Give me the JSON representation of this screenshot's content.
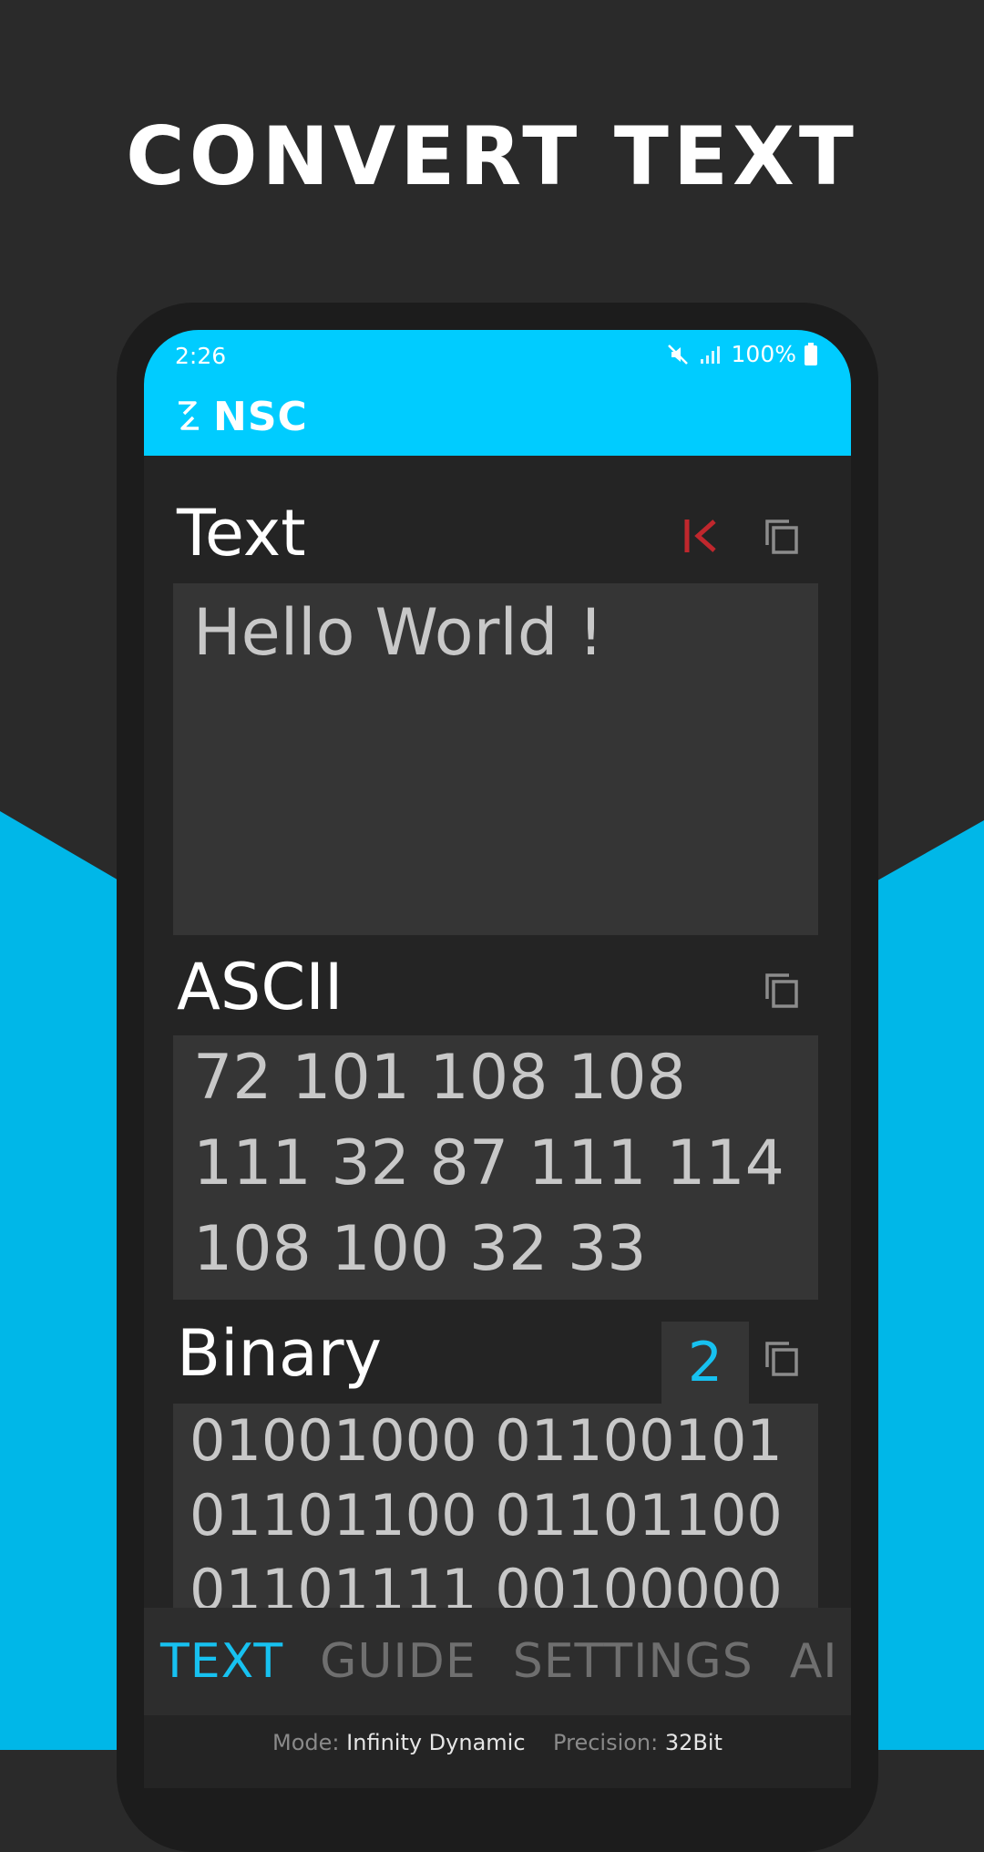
{
  "headline": "CONVERT TEXT",
  "colors": {
    "accent": "#00ccff",
    "promo_blue": "#00b7e8",
    "active_tab": "#17c1f0",
    "clear_icon": "#c0272d",
    "background": "#2a2a2a",
    "field": "#353535"
  },
  "status_bar": {
    "time": "2:26",
    "battery": "100%",
    "icons": [
      "mute-icon",
      "signal-icon",
      "battery-icon"
    ]
  },
  "app_bar": {
    "title": "NSC",
    "logo_icon": "convert-arrows-icon"
  },
  "text_section": {
    "label": "Text",
    "value": "Hello World !",
    "icons": [
      "clear-icon",
      "copy-icon"
    ]
  },
  "ascii_section": {
    "label": "ASCII",
    "value": "72 101 108 108\n111 32 87 111 114\n108 100 32 33",
    "icons": [
      "copy-icon"
    ]
  },
  "binary_section": {
    "label": "Binary",
    "base": "2",
    "value": "01001000 01100101\n01101100 01101100\n01101111 00100000",
    "icons": [
      "copy-icon"
    ]
  },
  "tabs": [
    {
      "label": "TEXT",
      "active": true
    },
    {
      "label": "GUIDE",
      "active": false
    },
    {
      "label": "SETTINGS",
      "active": false
    },
    {
      "label": "AI",
      "active": false
    }
  ],
  "mode_bar": {
    "mode_label": "Mode:",
    "mode_value": "Infinity Dynamic",
    "precision_label": "Precision:",
    "precision_value": "32Bit"
  }
}
